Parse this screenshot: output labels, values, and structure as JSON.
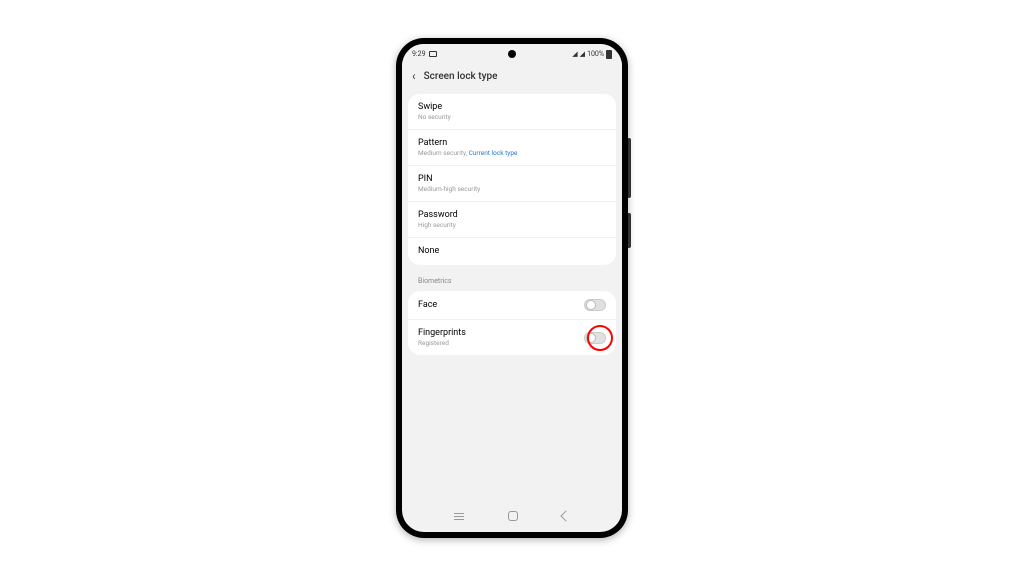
{
  "status": {
    "time": "9:29",
    "battery": "100%"
  },
  "header": {
    "title": "Screen lock type"
  },
  "lockTypes": [
    {
      "title": "Swipe",
      "sub": "No security"
    },
    {
      "title": "Pattern",
      "sub": "Medium security, ",
      "current": "Current lock type"
    },
    {
      "title": "PIN",
      "sub": "Medium-high security"
    },
    {
      "title": "Password",
      "sub": "High security"
    },
    {
      "title": "None",
      "sub": ""
    }
  ],
  "biometrics": {
    "label": "Biometrics",
    "items": [
      {
        "title": "Face",
        "sub": "",
        "toggle": false
      },
      {
        "title": "Fingerprints",
        "sub": "Registered",
        "toggle": false,
        "highlight": true
      }
    ]
  }
}
